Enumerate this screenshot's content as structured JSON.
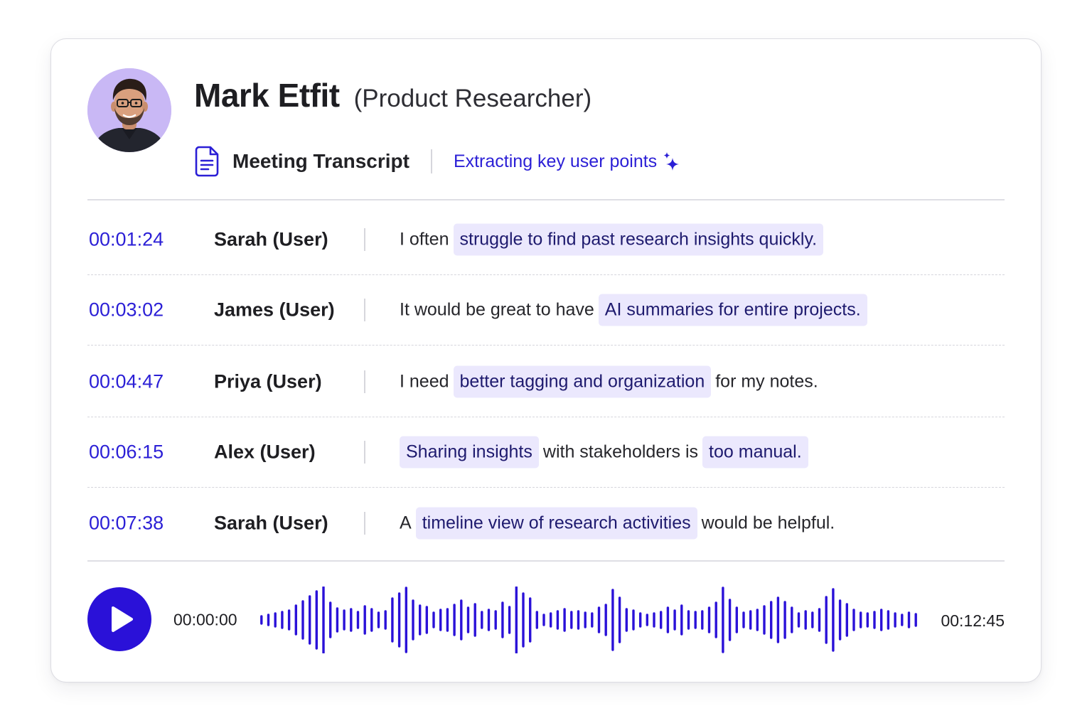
{
  "header": {
    "name": "Mark Etfit",
    "role": "(Product Researcher)",
    "avatar_icon": "person-avatar",
    "document_icon": "document-icon",
    "title": "Meeting Transcript",
    "status": "Extracting key user points",
    "status_icon": "sparkle-icon"
  },
  "colors": {
    "accent": "#2b1fd6",
    "play_button": "#2a11d8",
    "highlight_bg": "#ebe8fd",
    "avatar_bg": "#c9b8f5"
  },
  "transcript": [
    {
      "time": "00:01:24",
      "speaker": "Sarah (User)",
      "segments": [
        {
          "text": "I often",
          "highlight": false
        },
        {
          "text": "struggle to find past research insights quickly.",
          "highlight": true
        }
      ]
    },
    {
      "time": "00:03:02",
      "speaker": "James (User)",
      "segments": [
        {
          "text": "It would be great to have",
          "highlight": false
        },
        {
          "text": "AI summaries for entire projects.",
          "highlight": true
        }
      ]
    },
    {
      "time": "00:04:47",
      "speaker": "Priya (User)",
      "segments": [
        {
          "text": "I need",
          "highlight": false
        },
        {
          "text": "better tagging and organization",
          "highlight": true
        },
        {
          "text": "for my notes.",
          "highlight": false
        }
      ]
    },
    {
      "time": "00:06:15",
      "speaker": "Alex (User)",
      "segments": [
        {
          "text": "Sharing insights",
          "highlight": true
        },
        {
          "text": "with stakeholders is",
          "highlight": false
        },
        {
          "text": "too manual.",
          "highlight": true
        }
      ]
    },
    {
      "time": "00:07:38",
      "speaker": "Sarah (User)",
      "segments": [
        {
          "text": "A",
          "highlight": false
        },
        {
          "text": "timeline view of research activities",
          "highlight": true
        },
        {
          "text": "would be helpful.",
          "highlight": false
        }
      ]
    }
  ],
  "player": {
    "play_icon": "play-icon",
    "current_time": "00:00:00",
    "duration": "00:12:45",
    "progress": 0
  }
}
